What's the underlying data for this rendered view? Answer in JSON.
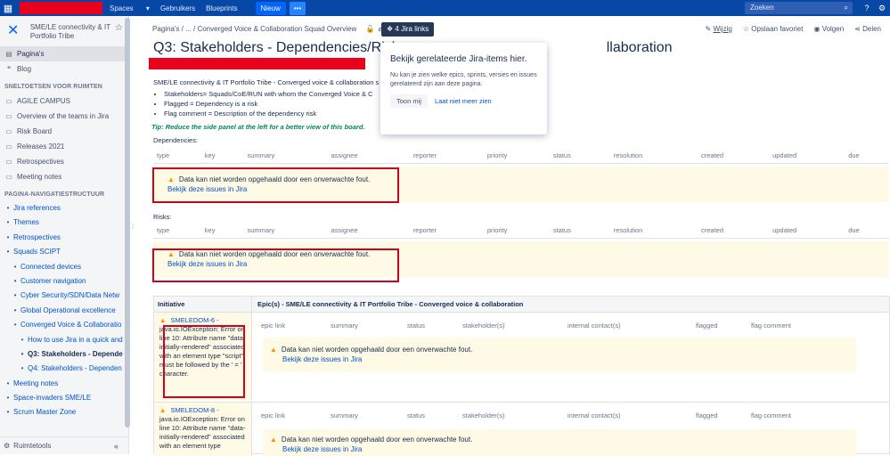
{
  "topbar": {
    "nav": [
      "Spaces",
      "Gebruikers",
      "Blueprints"
    ],
    "new_label": "Nieuw",
    "more_label": "•••",
    "search_placeholder": "Zoeken"
  },
  "sidebar": {
    "space_name": "SME/LE connectivity & IT Portfolio Tribe",
    "items": [
      "Pagina's",
      "Blog"
    ],
    "shortcuts_heading": "SNELTOETSEN VOOR RUIMTEN",
    "shortcuts": [
      "AGILE CAMPUS",
      "Overview of the teams in Jira",
      "Risk Board",
      "Releases 2021",
      "Retrospectives",
      "Meeting notes"
    ],
    "tree_heading": "PAGINA-NAVIGATIESTRUCTUUR",
    "tree": [
      "Jira references",
      "Themes",
      "Retrospectives",
      "Squads SCIPT",
      "Connected devices",
      "Customer navigation",
      "Cyber Security/SDN/Data Netw",
      "Global Operational excellence",
      "Converged Voice & Collaboratio",
      "How to use Jira in a quick and",
      "Q3: Stakeholders - Depende",
      "Q4: Stakeholders - Dependen",
      "Meeting notes",
      "Space-invaders SME/LE",
      "Scrum Master Zone"
    ],
    "footer": "Ruimtetools"
  },
  "page": {
    "breadcrumb": [
      "Pagina's",
      "...",
      "Converged Voice & Collaboration Squad Overview"
    ],
    "jira_links": "4 Jira links",
    "actions": [
      "Wijzig",
      "Opslaan favoriet",
      "Volgen",
      "Delen"
    ],
    "title_start": "Q3: Stakeholders - Dependencies/Risk",
    "title_end": "llaboration",
    "intro": "SME/LE connectivity & IT Portfolio Tribe - Converged voice & collaboration s",
    "bullets": [
      "Stakeholders= Squads/CoE/RUN with whom the Converged Voice & C",
      "Flagged = Dependency is a risk",
      "Flag comment = Description of the dependency risk"
    ],
    "tip": "Tip: Reduce the side panel at the left for a better view of this board.",
    "dependencies_label": "Dependencies:",
    "risks_label": "Risks:",
    "columns": [
      "type",
      "key",
      "summary",
      "assignee",
      "reporter",
      "priority",
      "status",
      "resolution",
      "created",
      "updated",
      "due"
    ],
    "error_msg": "Data kan niet worden opgehaald door een onverwachte fout.",
    "error_link": "Bekijk deze issues in Jira"
  },
  "popup": {
    "title": "Bekijk gerelateerde Jira-items hier.",
    "body": "Nu kan je zien welke epics, sprints, versies en issues gerelateerd zijn aan deze pagina.",
    "show": "Toon mij",
    "never": "Laat niet meer zien"
  },
  "epics": {
    "col_initiative": "Initiative",
    "col_epics": "Epic(s) - SME/LE connectivity & IT Portfolio Tribe - Converged voice & collaboration",
    "sub_columns": [
      "epic link",
      "summary",
      "status",
      "stakeholder(s)",
      "internal contact(s)",
      "flagged",
      "flag comment"
    ],
    "rows": [
      {
        "key": "SMELEDOM-6 -",
        "text": "java.io.IOException: Error on line 10: Attribute name \"data-initially-rendered\" associated with an element type \"script\" must be followed by the ' = ' character."
      },
      {
        "key": "SMELEDOM-8 -",
        "text": "java.io.IOException: Error on line 10: Attribute name \"data-initially-rendered\" associated with an element type"
      }
    ]
  }
}
